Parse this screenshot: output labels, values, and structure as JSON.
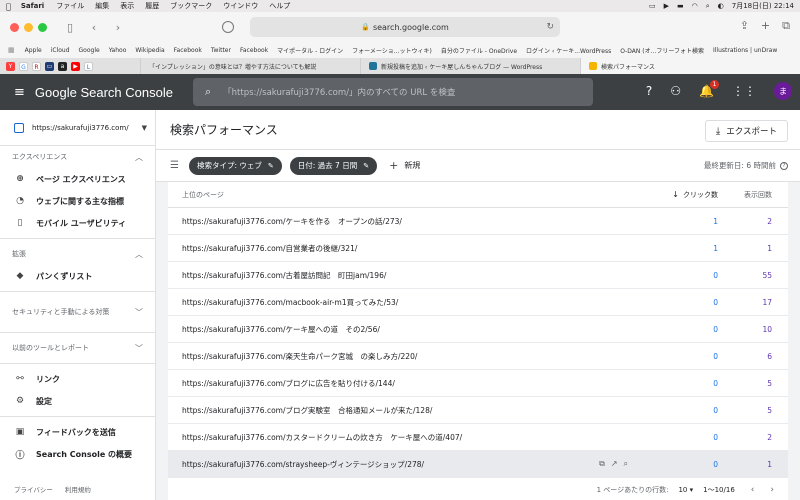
{
  "menubar": {
    "app": "Safari",
    "items": [
      "ファイル",
      "編集",
      "表示",
      "履歴",
      "ブックマーク",
      "ウインドウ",
      "ヘルプ"
    ],
    "clock": "7月18日(日)  22:14"
  },
  "browser": {
    "url": "search.google.com",
    "bookmarks": [
      "Apple",
      "iCloud",
      "Google",
      "Yahoo",
      "Wikipedia",
      "Facebook",
      "Twitter",
      "Facebook",
      "マイポータル - ログイン",
      "フォーメーショ...ットウィキ)",
      "自分のファイル - OneDrive",
      "ログイン ‹ ケーキ...WordPress",
      "O-DAN (オ...フリーフォト検索",
      "Illustrations | unDraw"
    ],
    "tabs": [
      {
        "label": "「インプレッション」の意味とは？増やす方法についても解説",
        "active": false
      },
      {
        "label": "新規投稿を追加 ‹ ケーキ屋しんちゃんブログ — WordPress",
        "active": false
      },
      {
        "label": "検索パフォーマンス",
        "active": true
      }
    ]
  },
  "header": {
    "brand": "Google Search Console",
    "search_placeholder": "「https://sakurafuji3776.com/」内のすべての URL を検査",
    "notification_count": "1",
    "avatar_letter": "ま"
  },
  "sidebar": {
    "property": "https://sakurafuji3776.com/",
    "section_experience": "エクスペリエンス",
    "experience_items": [
      "ページ エクスペリエンス",
      "ウェブに関する主な指標",
      "モバイル ユーザビリティ"
    ],
    "section_enhancements": "拡張",
    "enhancement_items": [
      "パンくずリスト"
    ],
    "section_security": "セキュリティと手動による対策",
    "section_legacy": "以前のツールとレポート",
    "other_items": [
      "リンク",
      "設定"
    ],
    "bottom_items": [
      "フィードバックを送信",
      "Search Console の概要"
    ],
    "footer": [
      "プライバシー",
      "利用規約"
    ]
  },
  "main": {
    "title": "検索パフォーマンス",
    "export_label": "エクスポート",
    "filters": [
      "検索タイプ: ウェブ",
      "日付: 過去 7 日間"
    ],
    "new_label": "新規",
    "updated": "最終更新日: 6 時間前"
  },
  "table": {
    "headers": {
      "page": "上位のページ",
      "clicks": "クリック数",
      "impressions": "表示回数"
    },
    "rows": [
      {
        "page": "https://sakurafuji3776.com/ケーキを作る　オープンの話/273/",
        "clicks": "1",
        "impressions": "2"
      },
      {
        "page": "https://sakurafuji3776.com/自営業者の後継/321/",
        "clicks": "1",
        "impressions": "1"
      },
      {
        "page": "https://sakurafuji3776.com/古着屋訪問記　町田jam/196/",
        "clicks": "0",
        "impressions": "55"
      },
      {
        "page": "https://sakurafuji3776.com/macbook-air-m1買ってみた/53/",
        "clicks": "0",
        "impressions": "17"
      },
      {
        "page": "https://sakurafuji3776.com/ケーキ屋への道　その2/56/",
        "clicks": "0",
        "impressions": "10"
      },
      {
        "page": "https://sakurafuji3776.com/楽天生命パーク宮城　の楽しみ方/220/",
        "clicks": "0",
        "impressions": "6"
      },
      {
        "page": "https://sakurafuji3776.com/ブログに広告を貼り付ける/144/",
        "clicks": "0",
        "impressions": "5"
      },
      {
        "page": "https://sakurafuji3776.com/ブログ実験室　合格通知メールが来た/128/",
        "clicks": "0",
        "impressions": "5"
      },
      {
        "page": "https://sakurafuji3776.com/カスタードクリームの炊き方　ケーキ屋への道/407/",
        "clicks": "0",
        "impressions": "2"
      },
      {
        "page": "https://sakurafuji3776.com/straysheep-ヴィンテージショップ/278/",
        "clicks": "0",
        "impressions": "1"
      }
    ],
    "rows_per_page_label": "1 ページあたりの行数:",
    "rows_per_page": "10",
    "range": "1〜10/16"
  }
}
